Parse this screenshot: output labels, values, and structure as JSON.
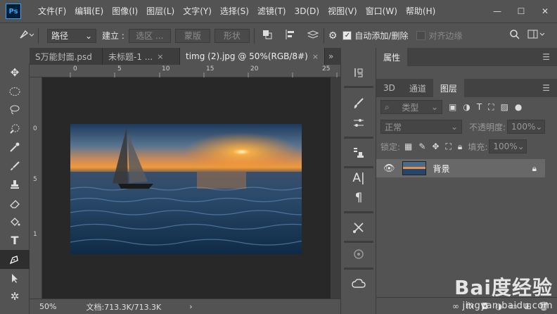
{
  "app": {
    "logo": "Ps"
  },
  "menu": [
    "文件(F)",
    "编辑(E)",
    "图像(I)",
    "图层(L)",
    "文字(Y)",
    "选择(S)",
    "滤镜(T)",
    "3D(D)",
    "视图(V)",
    "窗口(W)",
    "帮助(H)"
  ],
  "window_controls": {
    "minimize": "—",
    "maximize": "☐",
    "close": "✕"
  },
  "options": {
    "mode_value": "路径",
    "make_label": "建立 :",
    "selection_btn": "选区 ...",
    "mask_btn": "蒙版",
    "shape_btn": "形状",
    "auto_add_delete": "自动添加/删除",
    "auto_add_checked": true,
    "align_edges": "对齐边缘",
    "align_edges_checked": false
  },
  "tabs": [
    {
      "label": "S万能封面.psd",
      "close": "×",
      "active": false
    },
    {
      "label": "未标题-1 ...",
      "close": "×",
      "active": false
    },
    {
      "label": "timg (2).jpg @ 50%(RGB/8#)",
      "close": "×",
      "active": true
    }
  ],
  "tab_overflow": "»",
  "ruler": {
    "top": [
      "0",
      "5",
      "10",
      "15",
      "20",
      "25"
    ],
    "left": [
      "0",
      "5",
      "1"
    ]
  },
  "status": {
    "zoom": "50%",
    "doc_info": "文档:713.3K/713.3K",
    "arrow": "›"
  },
  "panels": {
    "properties_tab": "属性",
    "tabs": [
      "3D",
      "通道",
      "图层"
    ],
    "active_tab": "图层",
    "filter_kind": "类型",
    "blend_mode": "正常",
    "opacity_label": "不透明度:",
    "opacity_value": "100%",
    "lock_label": "锁定:",
    "fill_label": "填充:",
    "fill_value": "100%",
    "layers": [
      {
        "name": "背景",
        "visible": true,
        "locked": true
      }
    ]
  },
  "watermark": {
    "logo": "Bai度经验",
    "url": "jingyan.baidu.com"
  }
}
